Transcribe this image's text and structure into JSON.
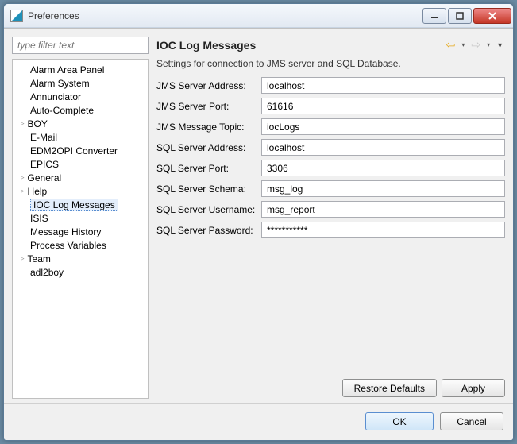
{
  "window": {
    "title": "Preferences"
  },
  "sidebar": {
    "filter_placeholder": "type filter text",
    "items": [
      {
        "label": "Alarm Area Panel",
        "expandable": false
      },
      {
        "label": "Alarm System",
        "expandable": false
      },
      {
        "label": "Annunciator",
        "expandable": false
      },
      {
        "label": "Auto-Complete",
        "expandable": false
      },
      {
        "label": "BOY",
        "expandable": true
      },
      {
        "label": "E-Mail",
        "expandable": false
      },
      {
        "label": "EDM2OPI Converter",
        "expandable": false
      },
      {
        "label": "EPICS",
        "expandable": false
      },
      {
        "label": "General",
        "expandable": true
      },
      {
        "label": "Help",
        "expandable": true
      },
      {
        "label": "IOC Log Messages",
        "expandable": false,
        "selected": true
      },
      {
        "label": "ISIS",
        "expandable": false
      },
      {
        "label": "Message History",
        "expandable": false
      },
      {
        "label": "Process Variables",
        "expandable": false
      },
      {
        "label": "Team",
        "expandable": true
      },
      {
        "label": "adl2boy",
        "expandable": false
      }
    ]
  },
  "page": {
    "title": "IOC Log Messages",
    "description": "Settings for connection to JMS server and SQL Database.",
    "fields": [
      {
        "label": "JMS Server Address:",
        "value": "localhost"
      },
      {
        "label": "JMS Server Port:",
        "value": "61616"
      },
      {
        "label": "JMS Message Topic:",
        "value": "iocLogs"
      },
      {
        "label": "SQL Server Address:",
        "value": "localhost"
      },
      {
        "label": "SQL Server Port:",
        "value": "3306"
      },
      {
        "label": "SQL Server Schema:",
        "value": "msg_log"
      },
      {
        "label": "SQL Server Username:",
        "value": "msg_report"
      },
      {
        "label": "SQL Server Password:",
        "value": "***********"
      }
    ],
    "buttons": {
      "restore": "Restore Defaults",
      "apply": "Apply"
    }
  },
  "footer": {
    "ok": "OK",
    "cancel": "Cancel"
  }
}
